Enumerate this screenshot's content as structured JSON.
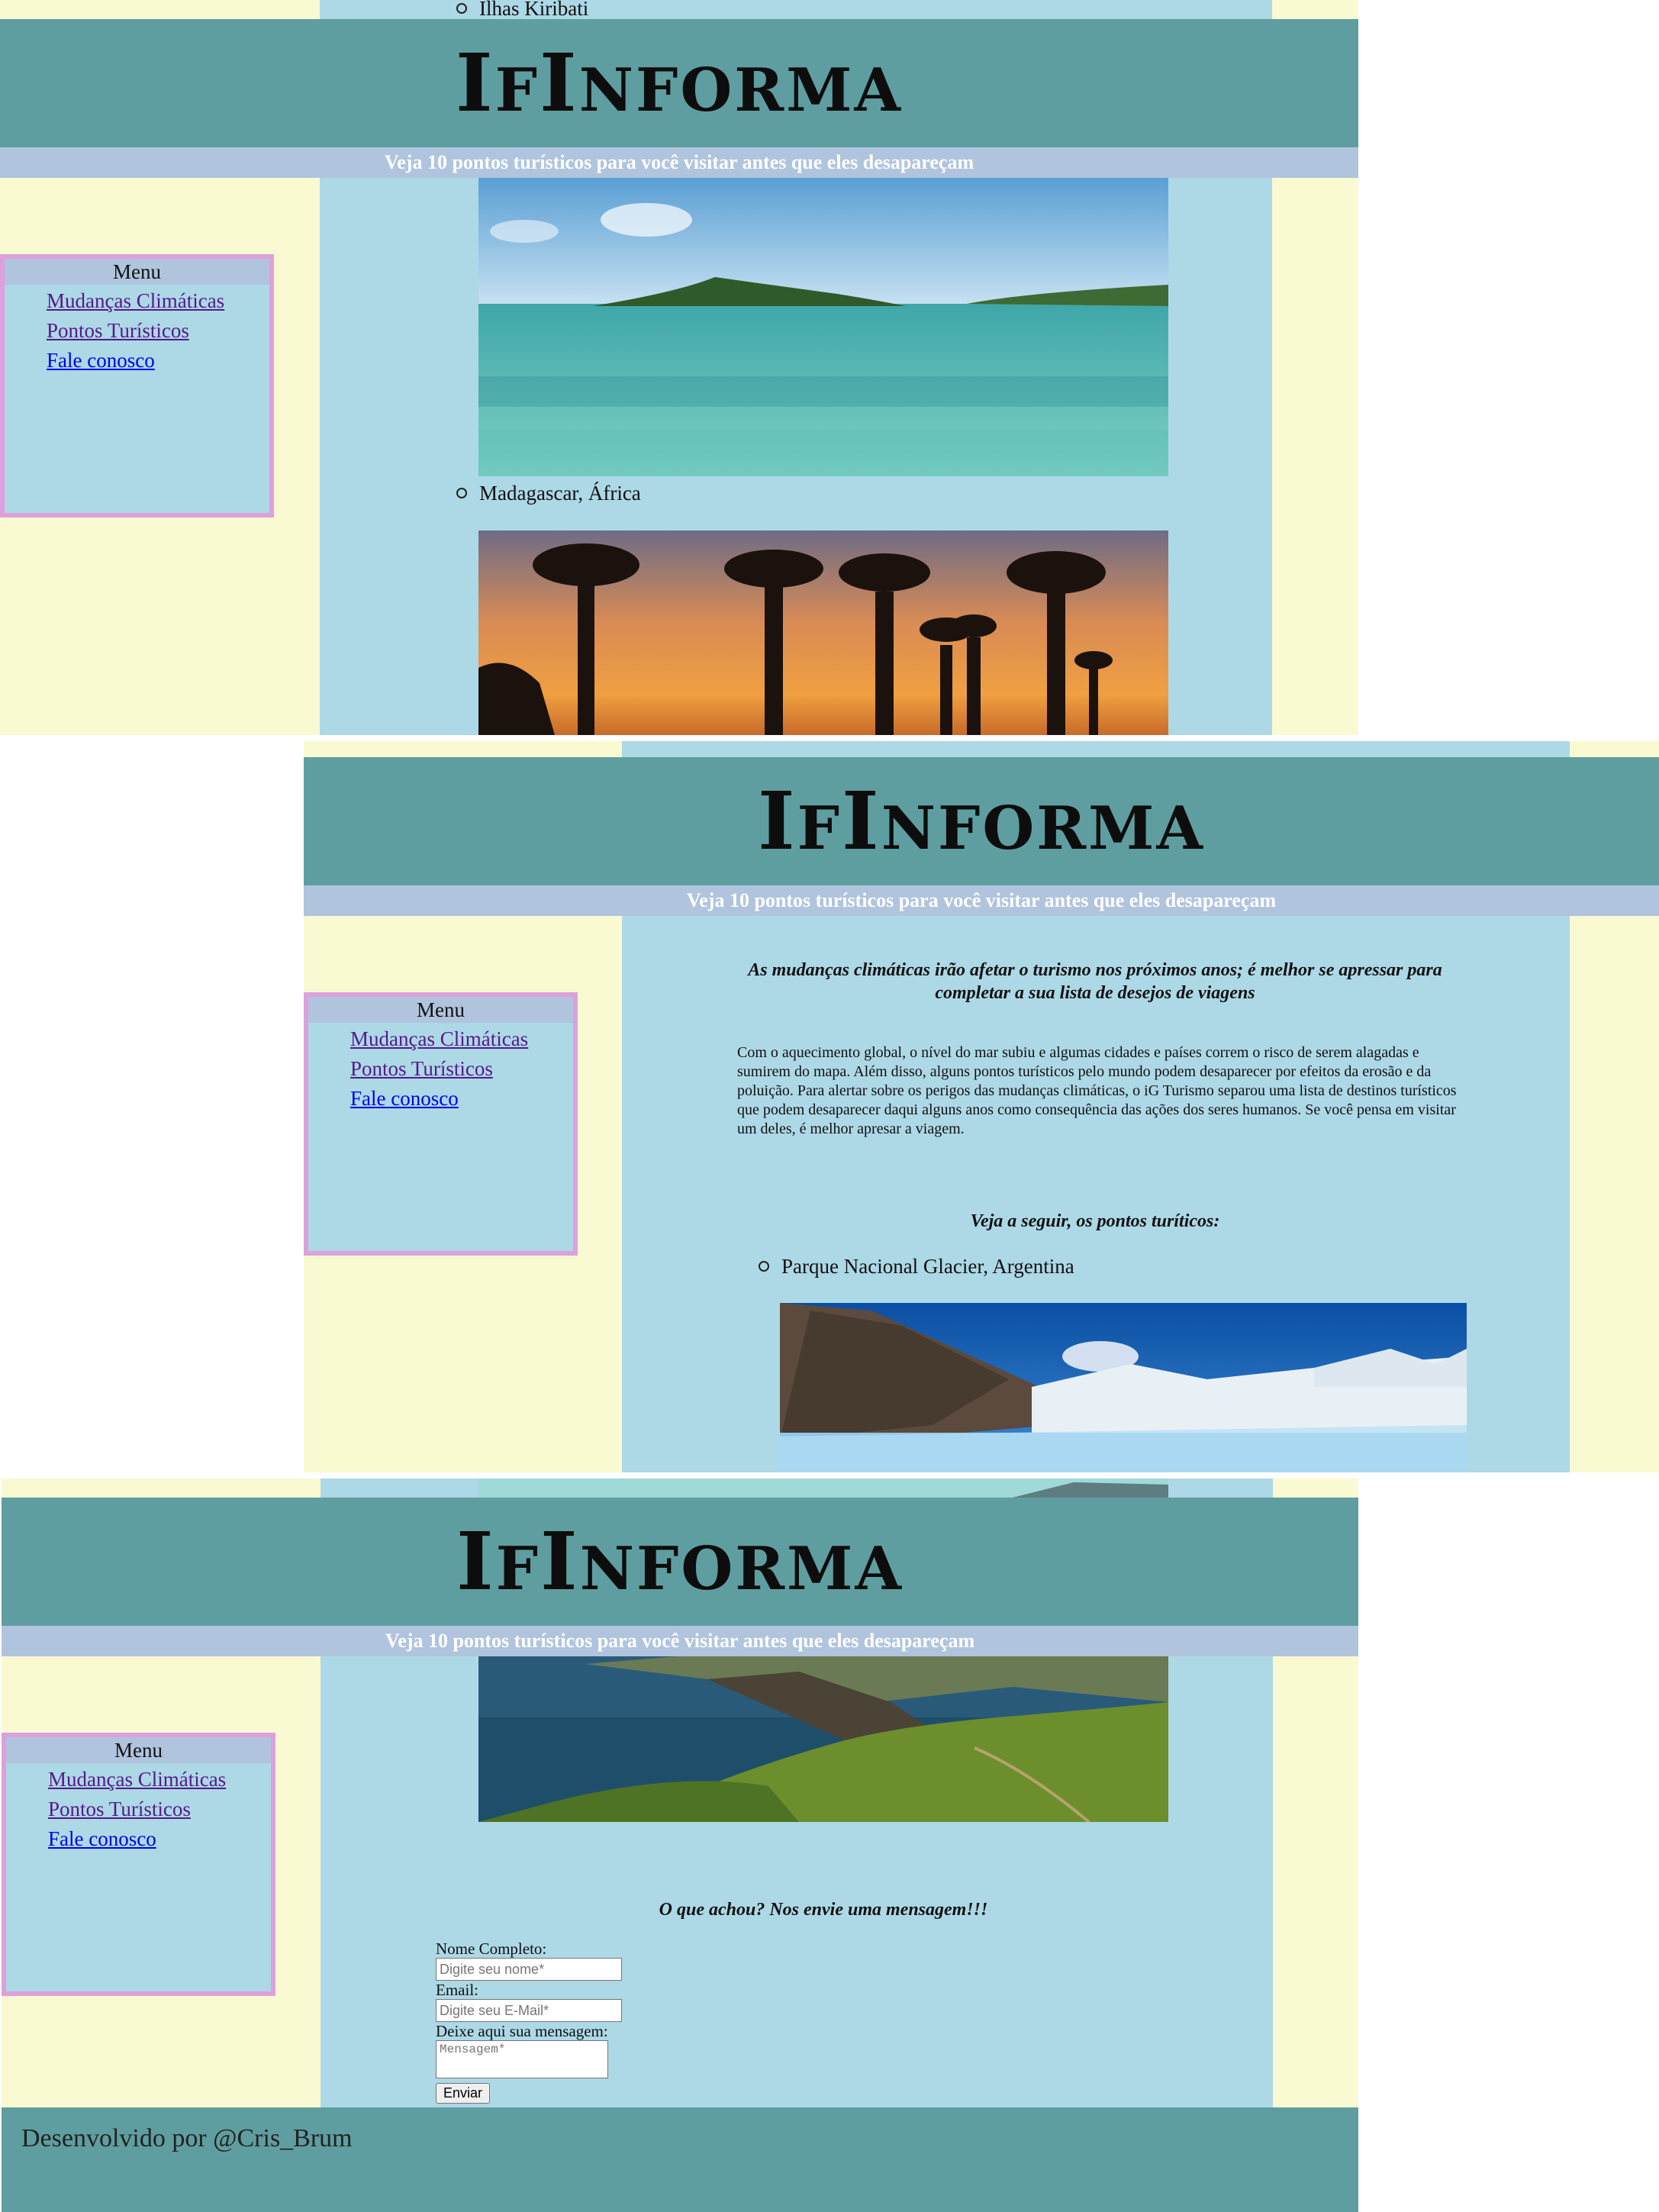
{
  "site": {
    "logo_big_i1": "I",
    "logo_small_f": "F",
    "logo_big_i2": "I",
    "logo_small_nforma": "NFORMA",
    "subtitle": "Veja 10 pontos turísticos para você visitar antes que eles desapareçam"
  },
  "menu": {
    "heading": "Menu",
    "items": [
      {
        "label": "Mudanças Climáticas"
      },
      {
        "label": "Pontos Turísticos"
      },
      {
        "label": "Fale conosco"
      }
    ]
  },
  "panel1": {
    "top_item": "Ilhas Kiribati",
    "item2": "Madagascar, África"
  },
  "panel2": {
    "headline": "As mudanças climáticas irão afetar o turismo nos próximos anos; é melhor se apressar para completar a sua lista de desejos de viagens",
    "intro": "Com o aquecimento global, o nível do mar subiu e algumas cidades e países correm o risco de serem alagadas e sumirem do mapa. Além disso, alguns pontos turísticos pelo mundo podem desaparecer por efeitos da erosão e da poluição. Para alertar sobre os perigos das mudanças climáticas, o iG Turismo separou uma lista de destinos turísticos que podem desaparecer daqui alguns anos como consequência das ações dos seres humanos. Se você pensa em visitar um deles, é melhor apresar a viagem.",
    "list_heading": "Veja a seguir, os pontos turíticos:",
    "item1": "Parque Nacional Glacier, Argentina"
  },
  "contact": {
    "heading": "O que achou? Nos envie uma mensagem!!!",
    "name_label": "Nome Completo:",
    "name_placeholder": "Digite seu nome*",
    "email_label": "Email:",
    "email_placeholder": "Digite seu E-Mail*",
    "message_label": "Deixe aqui sua mensagem:",
    "message_placeholder": "Mensagem*",
    "submit": "Enviar"
  },
  "footer": {
    "credit": "Desenvolvido por @Cris_Brum"
  },
  "colors": {
    "header": "#5f9ea0",
    "subbar": "#b0c4de",
    "content": "#add8e6",
    "page": "#fafad2",
    "menu_border": "#dda0dd"
  }
}
